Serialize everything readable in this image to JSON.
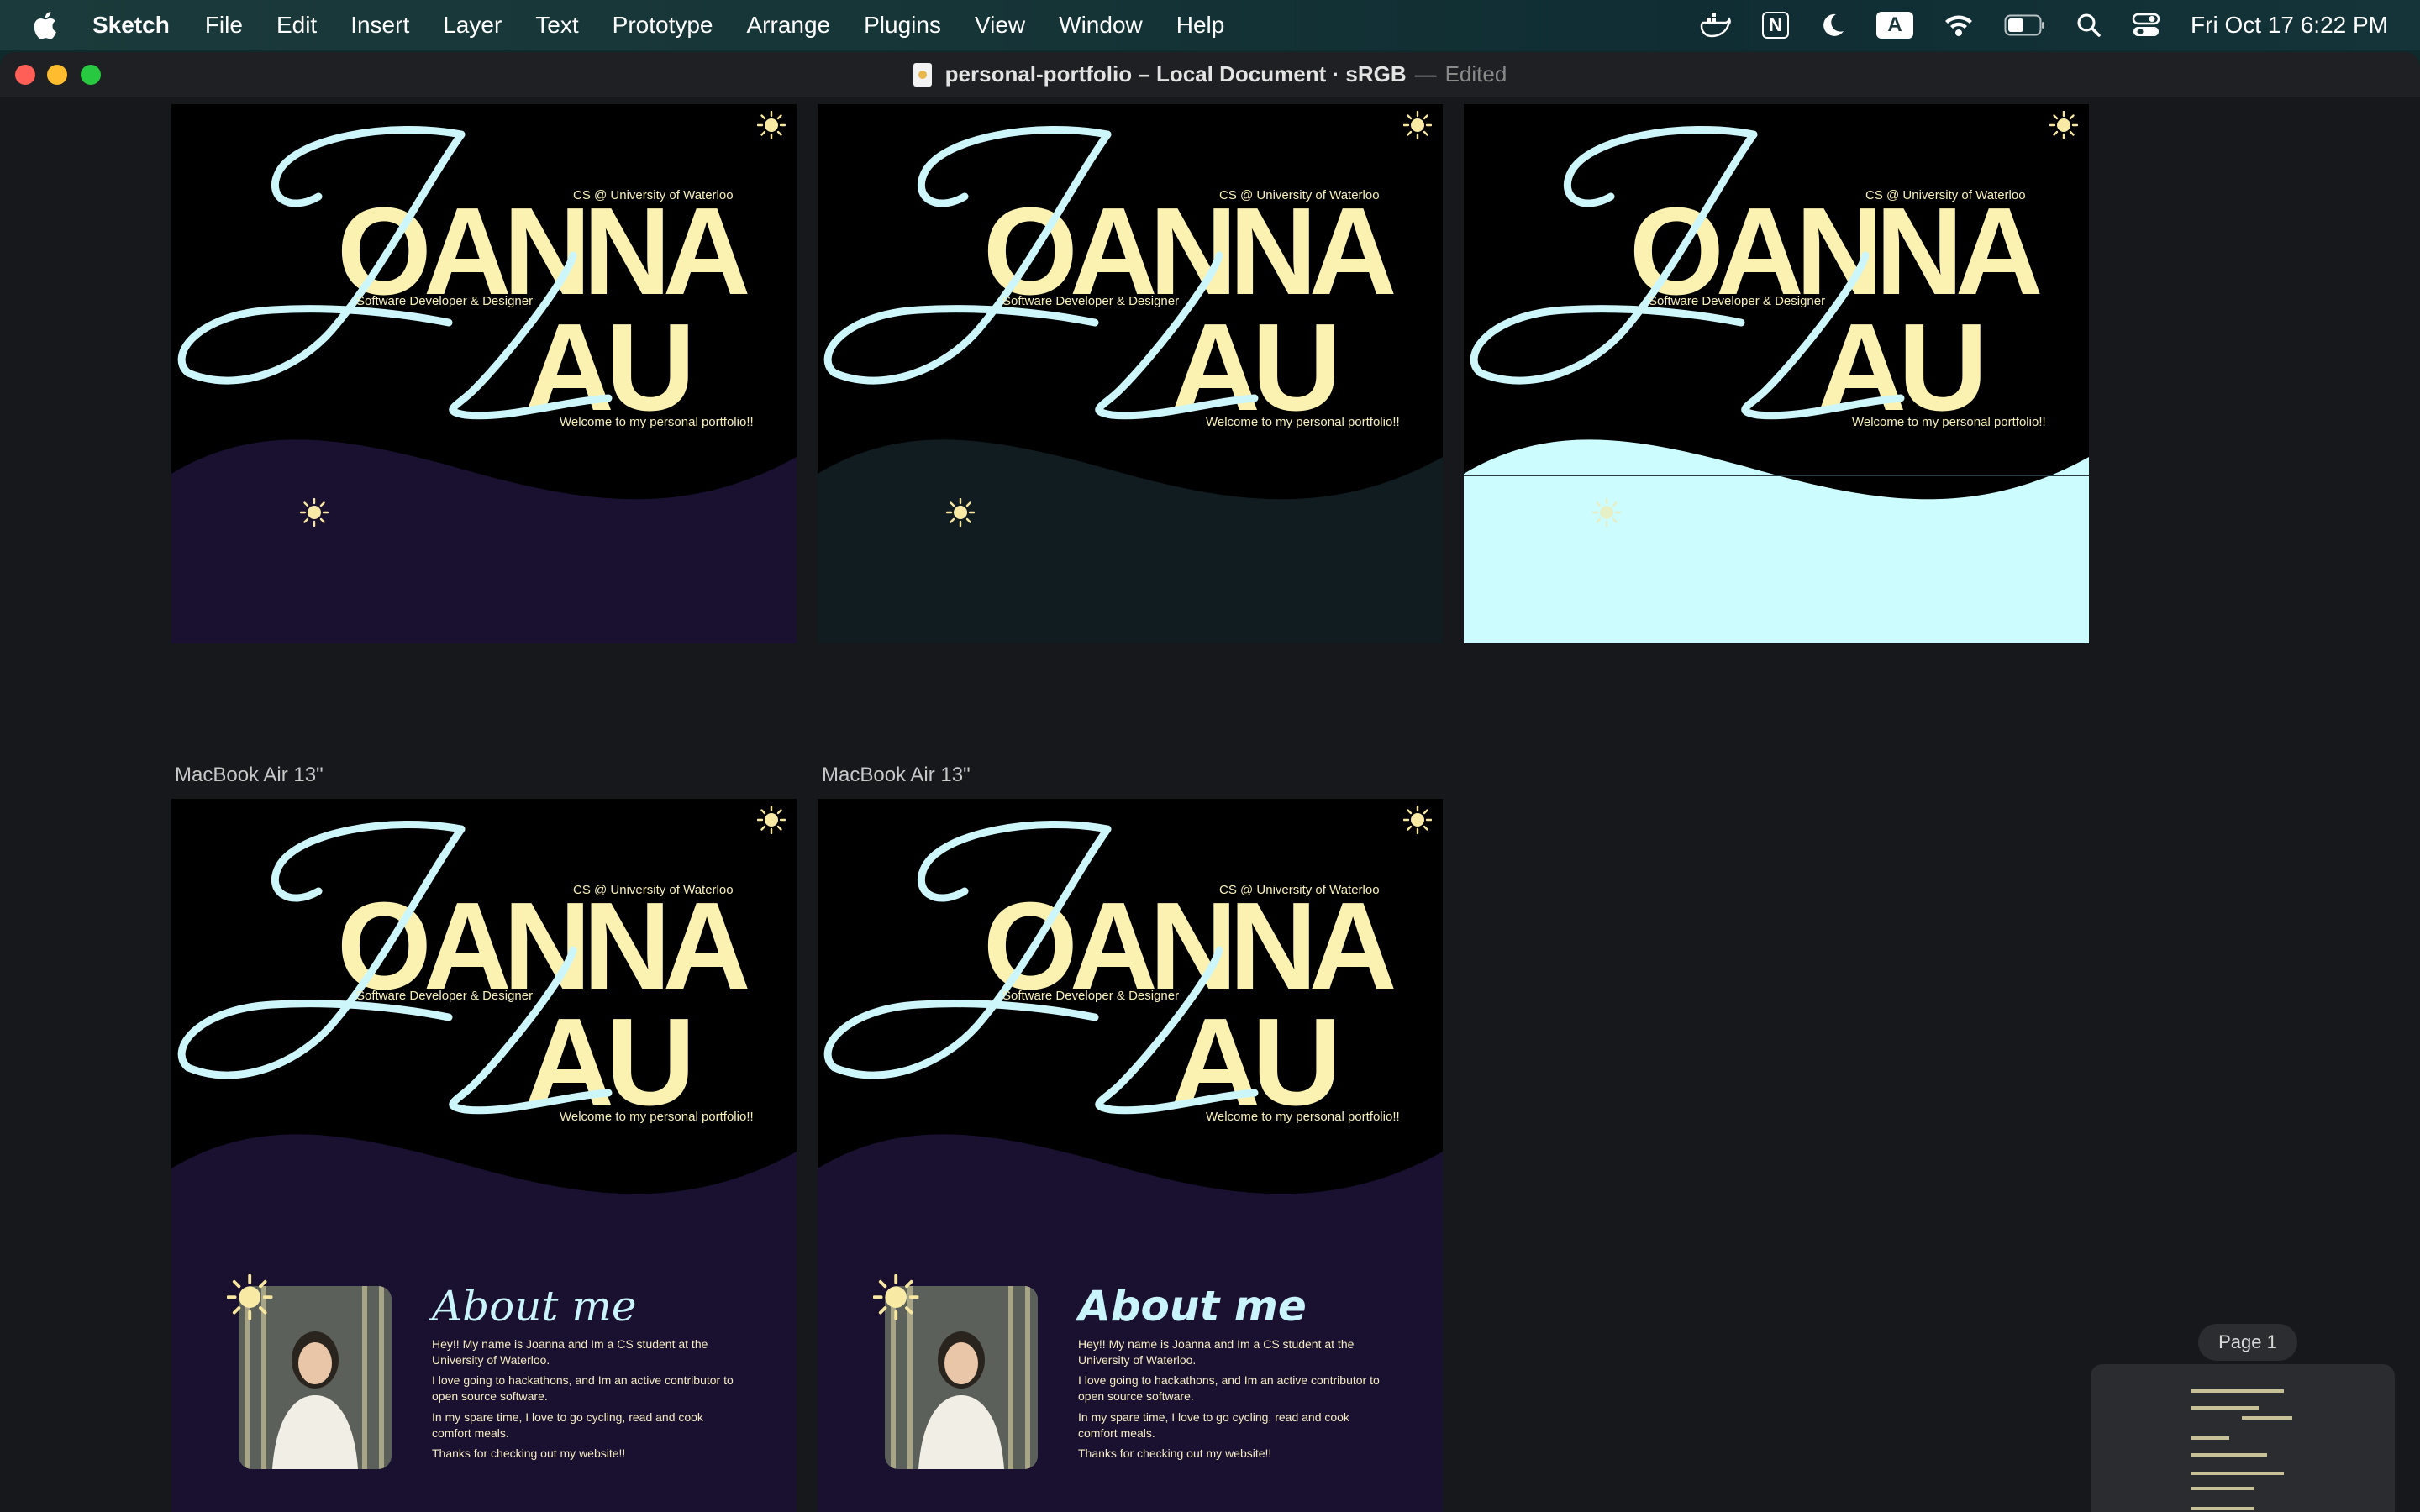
{
  "menubar": {
    "app_name": "Sketch",
    "items": [
      "File",
      "Edit",
      "Insert",
      "Layer",
      "Text",
      "Prototype",
      "Arrange",
      "Plugins",
      "View",
      "Window",
      "Help"
    ],
    "status_icons": [
      "docker-icon",
      "notion-icon",
      "moon-icon",
      "input-source-icon",
      "wifi-icon",
      "battery-icon",
      "spotlight-icon",
      "control-center-icon"
    ],
    "input_source": "A",
    "notion_letter": "N",
    "datetime": "Fri Oct 17  6:22 PM"
  },
  "window": {
    "title": "personal-portfolio – Local Document · sRGB",
    "separator": "—",
    "edited": "Edited"
  },
  "artboard_text": {
    "first_name": "OANNA",
    "last_name": "AU",
    "school": "CS @ University of Waterloo",
    "role": "Software Developer & Designer",
    "welcome": "Welcome to my personal portfolio!!"
  },
  "artboard_labels": {
    "a4": "MacBook Air 13\"",
    "a5": "MacBook Air 13\""
  },
  "about": {
    "title": "About me",
    "p1": "Hey!! My name is Joanna and Im a CS student at the University of Waterloo.",
    "p2": "I love going to hackathons, and Im an active contributor to open source software.",
    "p3": "In my spare time, I love to go cycling, read and cook comfort meals.",
    "p4": "Thanks for checking out my website!!"
  },
  "colors": {
    "cream": "#fbf2b2",
    "script_cyan": "#cdf6fb",
    "purple": "#1a1030",
    "teal": "#101c20",
    "light_cyan": "#cdfcfe"
  },
  "navigator": {
    "page_label": "Page 1"
  }
}
